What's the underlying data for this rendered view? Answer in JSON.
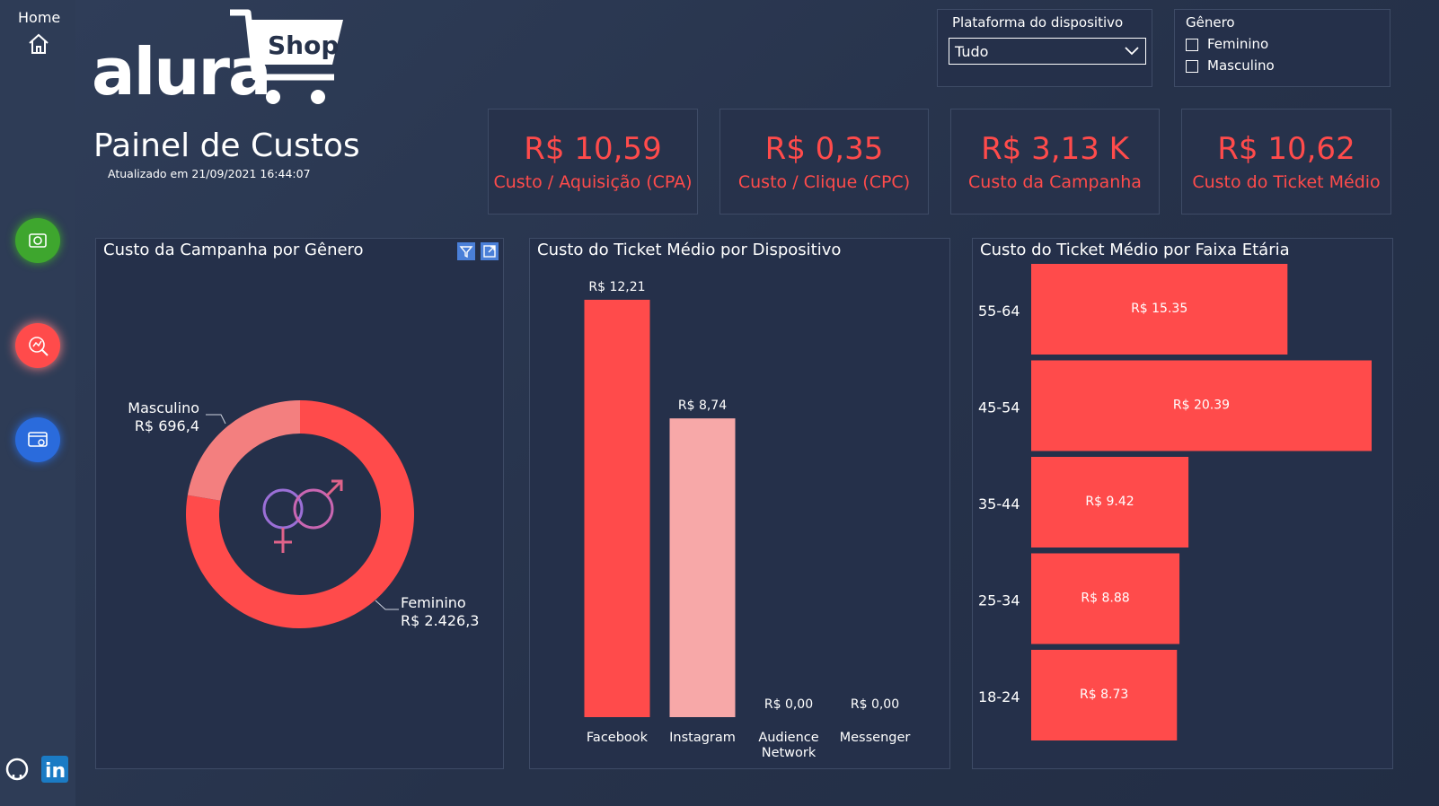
{
  "sidebar": {
    "home_label": "Home",
    "nav": [
      {
        "icon": "money-icon",
        "color": "#3ea62e"
      },
      {
        "icon": "cost-analysis-icon",
        "color": "#ff4b4b"
      },
      {
        "icon": "browser-icon",
        "color": "#2a6bdc"
      }
    ],
    "bottom_icons": [
      "github-icon",
      "linkedin-icon"
    ]
  },
  "header": {
    "logo_text": "alura",
    "logo_shop": "Shop",
    "title": "Painel de Custos",
    "updated": "Atualizado em 21/09/2021 16:44:07"
  },
  "filters": {
    "platform": {
      "label": "Plataforma do dispositivo",
      "value": "Tudo"
    },
    "gender": {
      "label": "Gênero",
      "options": [
        "Feminino",
        "Masculino"
      ]
    }
  },
  "kpis": [
    {
      "value": "R$ 10,59",
      "label": "Custo / Aquisição (CPA)"
    },
    {
      "value": "R$ 0,35",
      "label": "Custo / Clique (CPC)"
    },
    {
      "value": "R$ 3,13 K",
      "label": "Custo da Campanha"
    },
    {
      "value": "R$ 10,62",
      "label": "Custo do Ticket Médio"
    }
  ],
  "colors": {
    "accent": "#ff4b4b",
    "light": "#f7a8a8",
    "mid": "#f37f7f",
    "bg": "#26324a"
  },
  "chart_data": [
    {
      "type": "pie",
      "title": "Custo da Campanha por Gênero",
      "categories": [
        "Feminino",
        "Masculino"
      ],
      "values": [
        2426.3,
        696.4
      ],
      "value_labels": [
        "R$ 2.426,3",
        "R$ 696,4"
      ],
      "colors": [
        "#ff4b4b",
        "#f37f7f"
      ]
    },
    {
      "type": "bar",
      "title": "Custo do Ticket Médio por Dispositivo",
      "categories": [
        "Facebook",
        "Instagram",
        "Audience Network",
        "Messenger"
      ],
      "values": [
        12.21,
        8.74,
        0,
        0
      ],
      "value_labels": [
        "R$ 12,21",
        "R$ 8,74",
        "R$ 0,00",
        "R$ 0,00"
      ],
      "colors": [
        "#ff4b4b",
        "#f7a8a8",
        "#ff4b4b",
        "#ff4b4b"
      ]
    },
    {
      "type": "bar",
      "orientation": "horizontal",
      "title": "Custo do Ticket Médio por Faixa Etária",
      "categories": [
        "55-64",
        "45-54",
        "35-44",
        "25-34",
        "18-24"
      ],
      "values": [
        15.35,
        20.39,
        9.42,
        8.88,
        8.73
      ],
      "value_labels": [
        "R$ 15.35",
        "R$ 20.39",
        "R$ 9.42",
        "R$ 8.88",
        "R$ 8.73"
      ]
    }
  ]
}
